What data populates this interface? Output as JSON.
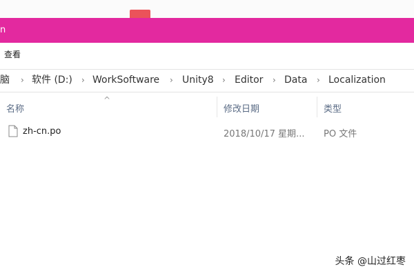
{
  "window": {
    "title_fragment": "n"
  },
  "ribbon": {
    "view_label": "查看"
  },
  "breadcrumb": {
    "items": [
      {
        "label": "脑"
      },
      {
        "label": "软件 (D:)"
      },
      {
        "label": "WorkSoftware"
      },
      {
        "label": "Unity8"
      },
      {
        "label": "Editor"
      },
      {
        "label": "Data"
      },
      {
        "label": "Localization"
      }
    ],
    "separator": "›"
  },
  "columns": {
    "name": "名称",
    "modified": "修改日期",
    "type": "类型",
    "sort_indicator": "^"
  },
  "files": [
    {
      "name": "zh-cn.po",
      "modified": "2018/10/17 星期...",
      "type": "PO 文件",
      "icon": "file-icon"
    }
  ],
  "watermark": "头条 @山过红枣",
  "colors": {
    "title_bar": "#e3299f",
    "accent_red": "#e7353d"
  }
}
